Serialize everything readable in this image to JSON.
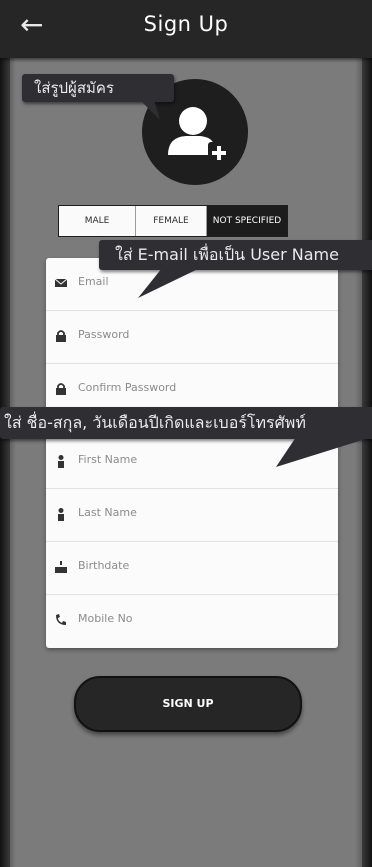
{
  "app_bar": {
    "back_icon": "arrow-left-icon",
    "title": "Sign Up"
  },
  "annotations": {
    "photo_tip": "ใส่รูปผู้สมัคร",
    "email_tip": "ใส่ E-mail เพื่อเป็น User Name",
    "profile_tip": "ใส่ ชื่อ-สกุล, วันเดือนปีเกิดและเบอร์โทรศัพท์"
  },
  "avatar": {
    "icon": "add-user-icon"
  },
  "gender": {
    "options": [
      "MALE",
      "FEMALE",
      "NOT SPECIFIED"
    ],
    "selected": "NOT SPECIFIED"
  },
  "form": {
    "fields": [
      {
        "placeholder": "Email",
        "icon": "envelope-icon"
      },
      {
        "placeholder": "Password",
        "icon": "lock-icon"
      },
      {
        "placeholder": "Confirm Password",
        "icon": "lock-icon"
      },
      {
        "placeholder": "First Name",
        "icon": "person-icon"
      },
      {
        "placeholder": "Last Name",
        "icon": "person-icon"
      },
      {
        "placeholder": "Birthdate",
        "icon": "cake-icon"
      },
      {
        "placeholder": "Mobile No",
        "icon": "phone-icon"
      }
    ]
  },
  "submit_label": "SIGN UP",
  "colors": {
    "appbar": "#262626",
    "selected_segment": "#1c1c1c",
    "tooltip": "#2f2f33"
  }
}
